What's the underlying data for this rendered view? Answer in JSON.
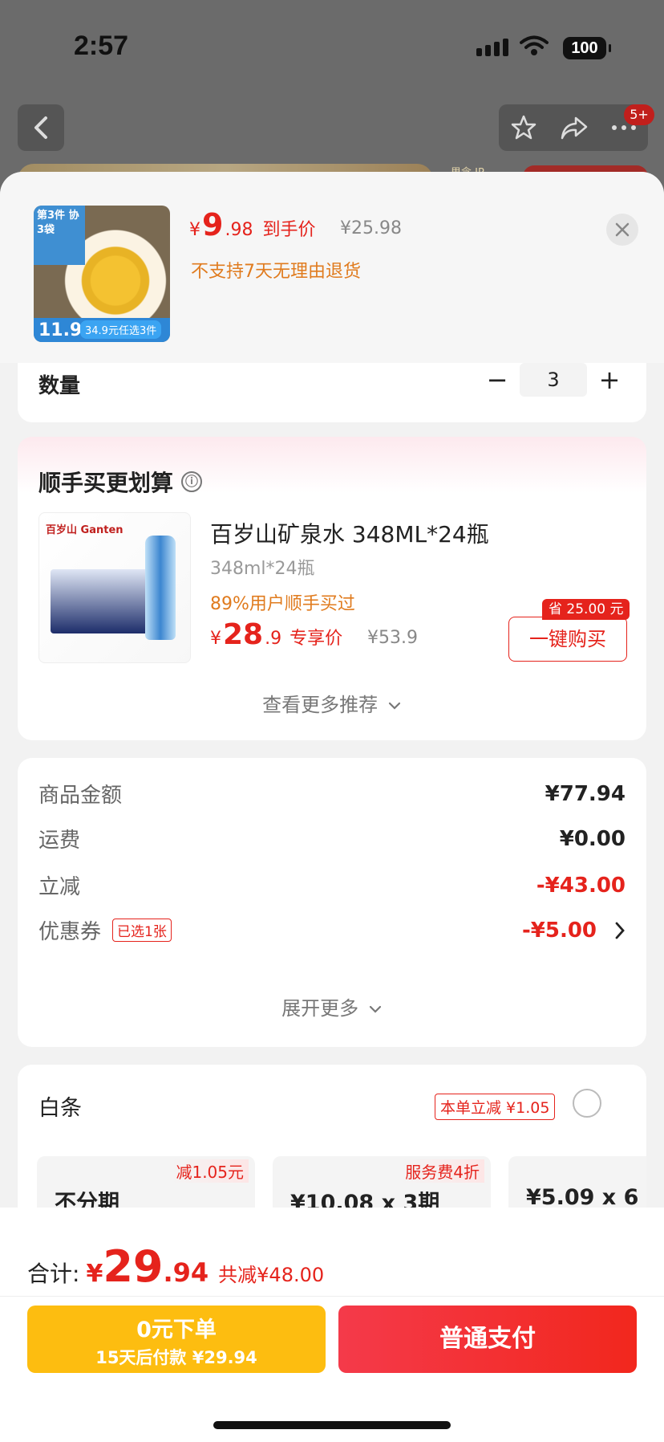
{
  "status_bar": {
    "time": "2:57",
    "battery": "100"
  },
  "nav": {
    "badge": "5+"
  },
  "background": {
    "right_text": "思念 JP"
  },
  "header": {
    "thumb_top_text": "第3件 协3袋",
    "thumb_price": "11.9",
    "thumb_offer": "34.9元任选3件",
    "price_yen": "¥",
    "price_int": "9",
    "price_dec": ".98",
    "price_label": "到手价",
    "original_price": "¥25.98",
    "return_note": "不支持7天无理由退货"
  },
  "quantity": {
    "label": "数量",
    "minus": "−",
    "value": "3",
    "plus": "+"
  },
  "recommend": {
    "title": "顺手买更划算",
    "info_icon": "ⓘ",
    "product": {
      "logo": "百岁山 Ganten",
      "name": "百岁山矿泉水 348ML*24瓶",
      "spec": "348ml*24瓶",
      "social": "89%用户顺手买过",
      "price_yen": "¥",
      "price_int": "28",
      "price_dec": ".9",
      "price_label": "专享价",
      "original_price": "¥53.9",
      "save_tag": "省 25.00 元",
      "buy_label": "一键购买"
    },
    "more_label": "查看更多推荐"
  },
  "summary": {
    "rows": [
      {
        "label": "商品金额",
        "value": "¥77.94"
      },
      {
        "label": "运费",
        "value": "¥0.00"
      },
      {
        "label": "立减",
        "value": "-¥43.00"
      },
      {
        "label": "优惠券",
        "tag": "已选1张",
        "value": "-¥5.00"
      }
    ],
    "expand_label": "展开更多"
  },
  "payment": {
    "title": "白条",
    "discount_tag": "本单立减 ¥1.05",
    "plans": [
      {
        "tag": "减1.05元",
        "text": "不分期"
      },
      {
        "tag": "服务费4折",
        "text": "¥10.08 x 3期"
      },
      {
        "tag": "",
        "text": "¥5.09 x 6"
      }
    ]
  },
  "bottom": {
    "total_label": "合计:",
    "total_yen": "¥",
    "total_int": "29",
    "total_dec": ".94",
    "total_save": "共减¥48.00",
    "later_line1": "0元下单",
    "later_line2": "15天后付款 ¥29.94",
    "pay_label": "普通支付"
  },
  "colors": {
    "accent_red": "#e5231c",
    "later_yellow": "#fdbd10",
    "orange": "#e07b1e"
  },
  "icons": [
    "back-icon",
    "star-icon",
    "share-icon",
    "more-icon",
    "close-icon",
    "info-icon",
    "chevron-down-icon",
    "chevron-right-icon"
  ]
}
